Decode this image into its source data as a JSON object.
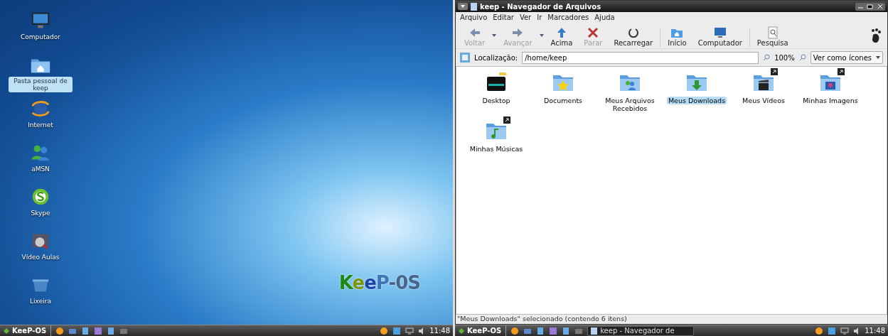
{
  "desktop": {
    "icons": [
      {
        "kind": "monitor",
        "label": "Computador",
        "selected": false
      },
      {
        "kind": "home",
        "label": "Pasta pessoal de keep",
        "selected": true
      },
      {
        "kind": "globe",
        "label": "Internet",
        "selected": false
      },
      {
        "kind": "people",
        "label": "aMSN",
        "selected": false
      },
      {
        "kind": "chat",
        "label": "Skype",
        "selected": false
      },
      {
        "kind": "video",
        "label": "Vídeo Aulas",
        "selected": false
      },
      {
        "kind": "trash",
        "label": "Lixeira",
        "selected": false
      }
    ],
    "logo": [
      {
        "text": "K",
        "color": "#1f8a14"
      },
      {
        "text": "e",
        "color": "#7f9408"
      },
      {
        "text": "e",
        "color": "#1f44a8"
      },
      {
        "text": "P",
        "color": "#3f74b8"
      },
      {
        "text": "-0S",
        "color": "#46668a"
      }
    ],
    "taskbar": {
      "start": "KeeP-OS",
      "launchers": [
        {
          "kind": "globe"
        },
        {
          "kind": "mail"
        },
        {
          "kind": "doc"
        },
        {
          "kind": "chart"
        },
        {
          "kind": "doc"
        },
        {
          "kind": "folder"
        }
      ],
      "clock": "11:48"
    }
  },
  "file_manager": {
    "title": "keep - Navegador de Arquivos",
    "menu": [
      {
        "label": "Arquivo"
      },
      {
        "label": "Editar"
      },
      {
        "label": "Ver"
      },
      {
        "label": "Ir"
      },
      {
        "label": "Marcadores"
      },
      {
        "label": "Ajuda"
      }
    ],
    "toolbar": [
      {
        "kind": "back",
        "label": "Voltar",
        "disabled": true,
        "dropdown": true
      },
      {
        "kind": "forward",
        "label": "Avançar",
        "disabled": true,
        "dropdown": true
      },
      {
        "kind": "up",
        "label": "Acima",
        "disabled": false,
        "dropdown": false
      },
      {
        "kind": "stop",
        "label": "Parar",
        "disabled": true,
        "dropdown": false
      },
      {
        "kind": "reload",
        "label": "Recarregar",
        "disabled": false,
        "dropdown": false
      },
      {
        "kind": "home",
        "label": "Início",
        "disabled": false,
        "dropdown": false
      },
      {
        "kind": "monitor",
        "label": "Computador",
        "disabled": false,
        "dropdown": false
      },
      {
        "kind": "search",
        "label": "Pesquisa",
        "disabled": false,
        "dropdown": false
      }
    ],
    "location": {
      "label": "Localização:",
      "value": "/home/keep"
    },
    "zoom": "100%",
    "view": "Ver como ícones",
    "files": [
      {
        "kind": "desktop",
        "label": "Desktop",
        "selected": false,
        "link": false
      },
      {
        "kind": "star",
        "label": "Documents",
        "selected": false,
        "link": false
      },
      {
        "kind": "people",
        "label": "Meus Arquivos Recebidos",
        "selected": false,
        "link": false
      },
      {
        "kind": "download",
        "label": "Meus Downloads",
        "selected": true,
        "link": false
      },
      {
        "kind": "video",
        "label": "Meus Vídeos",
        "selected": false,
        "link": true
      },
      {
        "kind": "image",
        "label": "Minhas Imagens",
        "selected": false,
        "link": true
      },
      {
        "kind": "music",
        "label": "Minhas Músicas",
        "selected": false,
        "link": true
      }
    ],
    "status": "\"Meus Downloads\" selecionado (contendo 6 itens)",
    "taskbar": {
      "start": "KeeP-OS",
      "launchers": [
        {
          "kind": "globe"
        },
        {
          "kind": "mail"
        },
        {
          "kind": "doc"
        },
        {
          "kind": "chart"
        },
        {
          "kind": "doc"
        },
        {
          "kind": "folder"
        }
      ],
      "tasks": [
        {
          "label": "keep - Navegador de"
        }
      ],
      "clock": "11:48"
    }
  }
}
